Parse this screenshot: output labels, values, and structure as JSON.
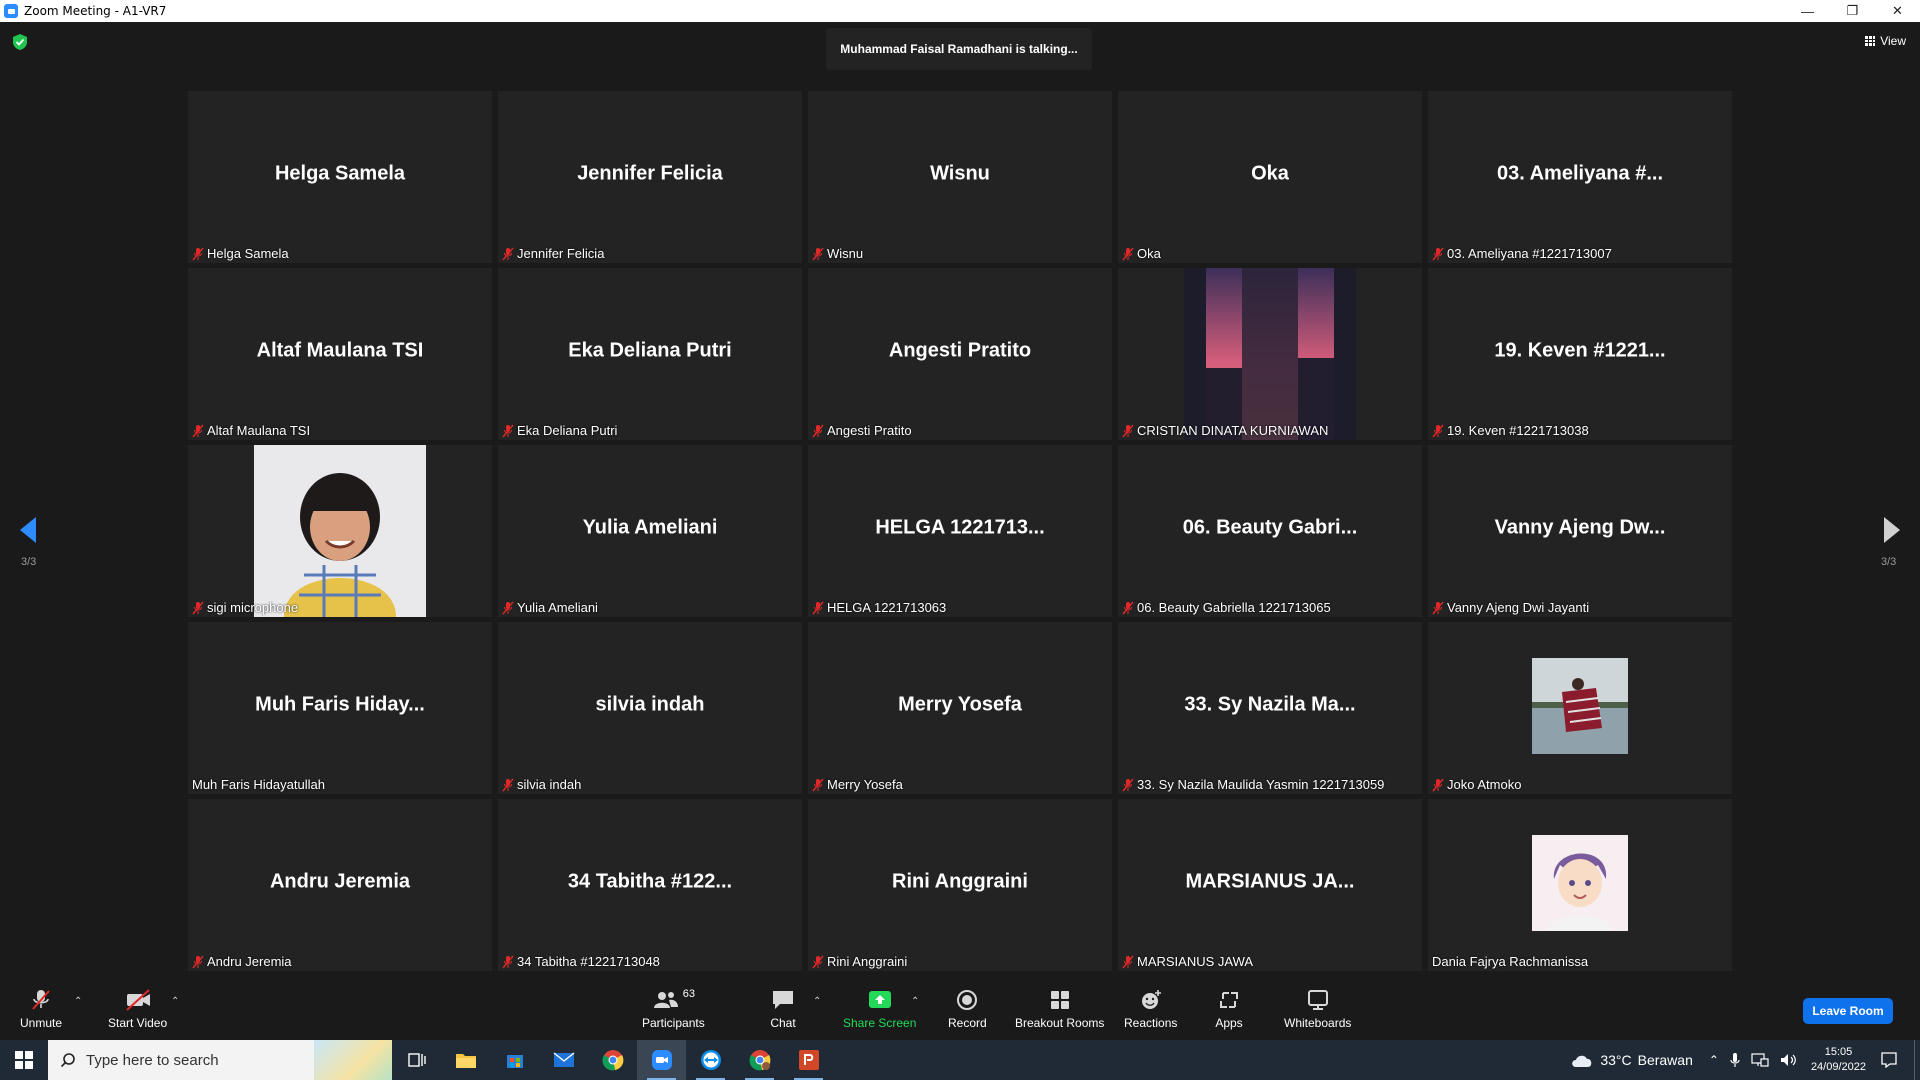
{
  "window": {
    "title": "Zoom Meeting - A1-VR7"
  },
  "talking_indicator": "Muhammad Faisal Ramadhani is talking...",
  "view_button": "View",
  "pager": {
    "left": "3/3",
    "right": "3/3"
  },
  "tiles": [
    {
      "center": "Helga Samela",
      "label": "Helga Samela",
      "muted": true
    },
    {
      "center": "Jennifer Felicia",
      "label": "Jennifer Felicia",
      "muted": true
    },
    {
      "center": "Wisnu",
      "label": "Wisnu",
      "muted": true
    },
    {
      "center": "Oka",
      "label": "Oka",
      "muted": true
    },
    {
      "center": "03. Ameliyana #...",
      "label": "03. Ameliyana #1221713007",
      "muted": true
    },
    {
      "center": "Altaf Maulana TSI",
      "label": "Altaf Maulana TSI",
      "muted": true
    },
    {
      "center": "Eka Deliana Putri",
      "label": "Eka Deliana Putri",
      "muted": true
    },
    {
      "center": "Angesti Pratito",
      "label": "Angesti Pratito",
      "muted": true
    },
    {
      "center": "",
      "label": "CRISTIAN DINATA KURNIAWAN",
      "muted": true,
      "photo": "sunset-building"
    },
    {
      "center": "19. Keven #1221...",
      "label": "19. Keven #1221713038",
      "muted": true
    },
    {
      "center": "",
      "label": "sigi microphone",
      "muted": true,
      "photo": "child-portrait"
    },
    {
      "center": "Yulia Ameliani",
      "label": "Yulia Ameliani",
      "muted": true
    },
    {
      "center": "HELGA 1221713...",
      "label": "HELGA 1221713063",
      "muted": true
    },
    {
      "center": "06. Beauty Gabri...",
      "label": "06. Beauty Gabriella 1221713065",
      "muted": true
    },
    {
      "center": "Vanny Ajeng Dw...",
      "label": "Vanny Ajeng Dwi Jayanti",
      "muted": true
    },
    {
      "center": "Muh Faris Hiday...",
      "label": "Muh Faris Hidayatullah",
      "muted": false
    },
    {
      "center": "silvia indah",
      "label": "silvia indah",
      "muted": true
    },
    {
      "center": "Merry Yosefa",
      "label": "Merry Yosefa",
      "muted": true
    },
    {
      "center": "33. Sy Nazila Ma...",
      "label": "33. Sy Nazila Maulida Yasmin 1221713059",
      "muted": true
    },
    {
      "center": "",
      "label": "Joko Atmoko",
      "muted": true,
      "photo": "landscape-person"
    },
    {
      "center": "Andru Jeremia",
      "label": "Andru Jeremia",
      "muted": true
    },
    {
      "center": "34 Tabitha #122...",
      "label": "34 Tabitha #1221713048",
      "muted": true
    },
    {
      "center": "Rini Anggraini",
      "label": "Rini Anggraini",
      "muted": true
    },
    {
      "center": "MARSIANUS  JA...",
      "label": "MARSIANUS JAWA",
      "muted": true
    },
    {
      "center": "",
      "label": "Dania Fajrya Rachmanissa",
      "muted": false,
      "photo": "anime-avatar"
    }
  ],
  "toolbar": {
    "unmute": "Unmute",
    "start_video": "Start Video",
    "participants": "Participants",
    "participants_count": "63",
    "chat": "Chat",
    "share_screen": "Share Screen",
    "record": "Record",
    "breakout_rooms": "Breakout Rooms",
    "reactions": "Reactions",
    "apps": "Apps",
    "whiteboards": "Whiteboards",
    "leave_room": "Leave Room"
  },
  "taskbar": {
    "search_placeholder": "Type here to search",
    "weather_temp": "33°C",
    "weather_desc": "Berawan",
    "time": "15:05",
    "date": "24/09/2022"
  },
  "colors": {
    "background": "#1a1a1a",
    "tile": "#232323",
    "muted_red": "#e02828",
    "share_green": "#23d959",
    "leave_blue": "#0e72ed",
    "pager_blue": "#2d8cff"
  }
}
